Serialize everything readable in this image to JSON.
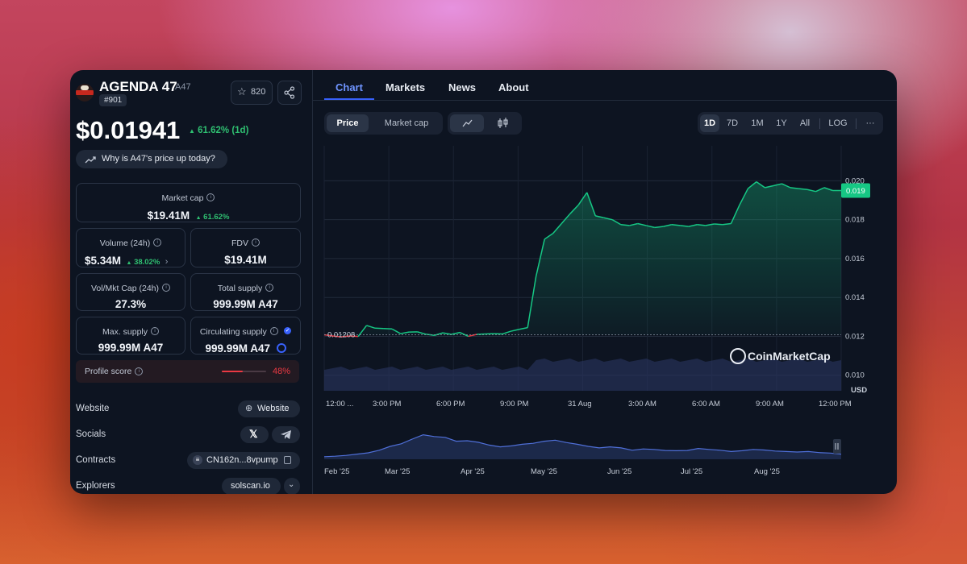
{
  "coin": {
    "name": "AGENDA 47",
    "symbol": "A47",
    "rank": "#901",
    "watchlist_count": "820",
    "price": "$0.01941",
    "change": "61.62% (1d)",
    "why_text": "Why is A47's price up today?"
  },
  "stats": {
    "market_cap": {
      "label": "Market cap",
      "value": "$19.41M",
      "change": "61.62%"
    },
    "volume": {
      "label": "Volume (24h)",
      "value": "$5.34M",
      "change": "38.02%"
    },
    "fdv": {
      "label": "FDV",
      "value": "$19.41M"
    },
    "vol_mkt_cap": {
      "label": "Vol/Mkt Cap (24h)",
      "value": "27.3%"
    },
    "total_supply": {
      "label": "Total supply",
      "value": "999.99M A47"
    },
    "max_supply": {
      "label": "Max. supply",
      "value": "999.99M A47"
    },
    "circulating_supply": {
      "label": "Circulating supply",
      "value": "999.99M A47"
    },
    "profile_score": {
      "label": "Profile score",
      "value": "48%",
      "fraction": 0.48
    }
  },
  "links": {
    "website_label": "Website",
    "website_value": "Website",
    "socials_label": "Socials",
    "contracts_label": "Contracts",
    "contract_value": "CN162n...8vpump",
    "explorers_label": "Explorers",
    "explorer_value": "solscan.io"
  },
  "tabs": [
    "Chart",
    "Markets",
    "News",
    "About"
  ],
  "chart_controls": {
    "type_options": [
      "Price",
      "Market cap"
    ],
    "ranges": [
      "1D",
      "7D",
      "1M",
      "1Y",
      "All",
      "LOG"
    ],
    "more": "···"
  },
  "colors": {
    "accent": "#3861fb",
    "up": "#16c784",
    "down": "#ea3943",
    "panel": "#0d1421"
  },
  "chart_data": {
    "type": "area",
    "x_ticks": [
      "12:00 ...",
      "3:00 PM",
      "6:00 PM",
      "9:00 PM",
      "31 Aug",
      "3:00 AM",
      "6:00 AM",
      "9:00 AM",
      "12:00 PM"
    ],
    "y_ticks": [
      "0.020",
      "0.018",
      "0.016",
      "0.014",
      "0.012",
      "0.010"
    ],
    "ylim": [
      0.0092,
      0.0218
    ],
    "y_unit": "USD",
    "current_label": "0.019",
    "reference_label": "0.01208",
    "watermark": "CoinMarketCap",
    "series": [
      {
        "values": [
          0.01208,
          0.01202,
          0.01197,
          0.01202,
          0.01199,
          0.01256,
          0.01242,
          0.0124,
          0.01238,
          0.01214,
          0.01222,
          0.01223,
          0.01211,
          0.01205,
          0.01218,
          0.0121,
          0.0122,
          0.012,
          0.0121,
          0.01212,
          0.01214,
          0.01212,
          0.01226,
          0.01236,
          0.01245,
          0.0151,
          0.017,
          0.0173,
          0.0178,
          0.0183,
          0.01876,
          0.0194,
          0.0182,
          0.0181,
          0.018,
          0.01775,
          0.0177,
          0.0178,
          0.0177,
          0.0176,
          0.01765,
          0.01775,
          0.0177,
          0.01765,
          0.01775,
          0.0177,
          0.01778,
          0.01775,
          0.0178,
          0.01875,
          0.0196,
          0.01995,
          0.01965,
          0.01975,
          0.01985,
          0.01965,
          0.0196,
          0.01955,
          0.01945,
          0.01965,
          0.0195,
          0.0195
        ]
      }
    ],
    "navigator": {
      "x_ticks": [
        "Feb '25",
        "Mar '25",
        "Apr '25",
        "May '25",
        "Jun '25",
        "Jul '25",
        "Aug '25"
      ],
      "values": [
        0.1,
        0.12,
        0.15,
        0.2,
        0.25,
        0.35,
        0.5,
        0.6,
        0.78,
        0.95,
        0.88,
        0.85,
        0.7,
        0.72,
        0.66,
        0.55,
        0.48,
        0.52,
        0.58,
        0.62,
        0.7,
        0.74,
        0.65,
        0.58,
        0.5,
        0.44,
        0.48,
        0.44,
        0.35,
        0.4,
        0.38,
        0.34,
        0.33,
        0.34,
        0.42,
        0.38,
        0.35,
        0.3,
        0.33,
        0.38,
        0.36,
        0.32,
        0.3,
        0.28,
        0.3,
        0.26,
        0.24,
        0.2
      ]
    }
  }
}
